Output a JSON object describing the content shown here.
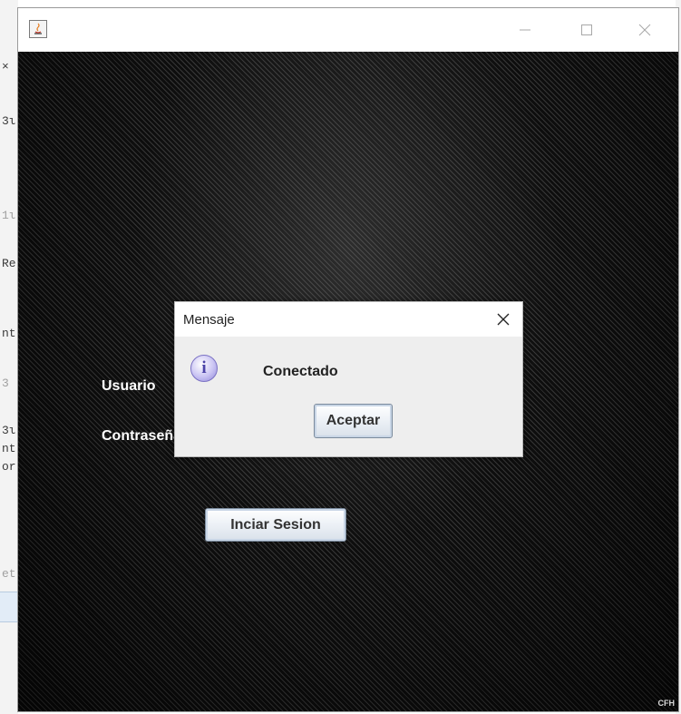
{
  "background_ide": {
    "fragments": [
      "×",
      "3ι",
      "1ι",
      "Re",
      "nt",
      "3",
      "3ι",
      "nt",
      "or",
      "et"
    ]
  },
  "window": {
    "title": "",
    "controls": {
      "minimize": "minimize-icon",
      "maximize": "maximize-icon",
      "close": "close-icon"
    }
  },
  "login": {
    "user_label": "Usuario",
    "password_label": "Contraseña",
    "login_button": "Inciar Sesion",
    "watermark": "CFH"
  },
  "dialog": {
    "title": "Mensaje",
    "message": "Conectado",
    "ok_button": "Aceptar",
    "icon": "info-icon"
  }
}
